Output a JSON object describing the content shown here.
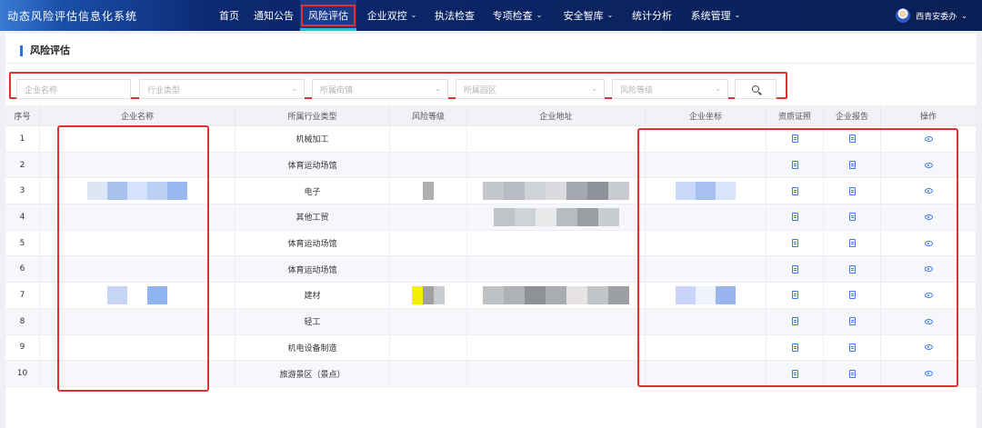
{
  "app": {
    "title": "动态风险评估信息化系统"
  },
  "nav": {
    "items": [
      {
        "label": "首页",
        "dropdown": false,
        "active": false
      },
      {
        "label": "通知公告",
        "dropdown": false,
        "active": false
      },
      {
        "label": "风险评估",
        "dropdown": false,
        "active": true
      },
      {
        "label": "企业双控",
        "dropdown": true,
        "active": false
      },
      {
        "label": "执法检查",
        "dropdown": false,
        "active": false
      },
      {
        "label": "专项检查",
        "dropdown": true,
        "active": false
      },
      {
        "label": "安全智库",
        "dropdown": true,
        "active": false
      },
      {
        "label": "统计分析",
        "dropdown": false,
        "active": false
      },
      {
        "label": "系统管理",
        "dropdown": true,
        "active": false
      }
    ],
    "user": "西青安委办"
  },
  "page": {
    "title": "风险评估"
  },
  "filters": {
    "company_name": "企业名称",
    "industry_type": "行业类型",
    "street": "所属街镇",
    "park": "所属园区",
    "risk_level": "风险等级"
  },
  "table": {
    "headers": [
      "序号",
      "企业名称",
      "所属行业类型",
      "风险等级",
      "企业地址",
      "企业坐标",
      "资质证照",
      "企业报告",
      "操作"
    ],
    "rows": [
      {
        "no": "1",
        "industry": "机械加工"
      },
      {
        "no": "2",
        "industry": "体育运动场馆"
      },
      {
        "no": "3",
        "industry": "电子"
      },
      {
        "no": "4",
        "industry": "其他工贸"
      },
      {
        "no": "5",
        "industry": "体育运动场馆"
      },
      {
        "no": "6",
        "industry": "体育运动场馆"
      },
      {
        "no": "7",
        "industry": "建材"
      },
      {
        "no": "8",
        "industry": "轻工"
      },
      {
        "no": "9",
        "industry": "机电设备制造"
      },
      {
        "no": "10",
        "industry": "旅游景区（景点）"
      }
    ]
  },
  "icons": {
    "license": "document-icon",
    "report": "document-icon",
    "action": "eye-icon",
    "search": "search-icon"
  },
  "colors": {
    "nav_bg": "#0b2566",
    "active_underline": "#23c4c9",
    "annotation_red": "#e03030",
    "link_blue": "#3b78e7"
  }
}
